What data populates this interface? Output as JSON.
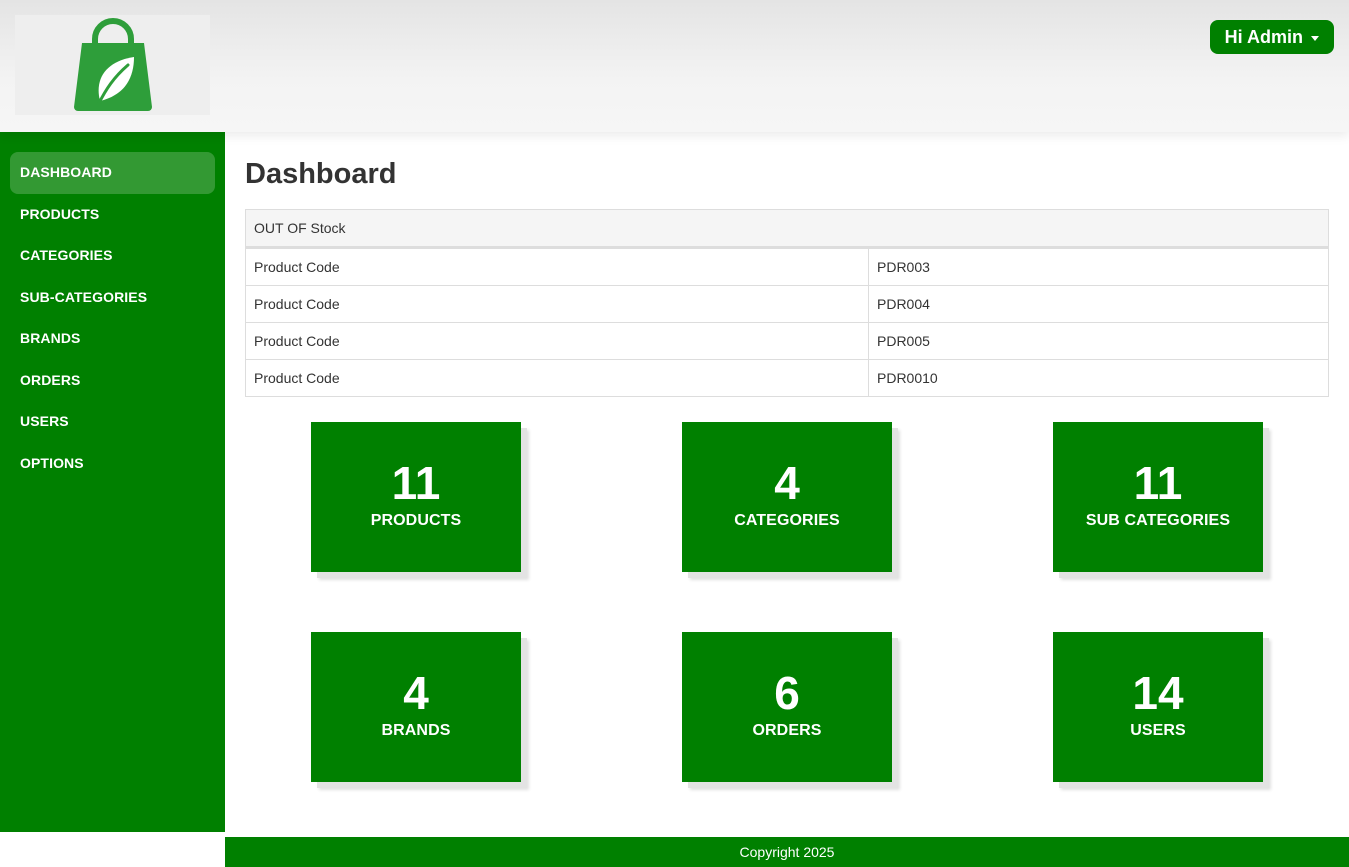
{
  "header": {
    "user_label": "Hi Admin",
    "brand_color": "#008000",
    "logo_icon": "shopping-bag-leaf-icon"
  },
  "sidebar": {
    "items": [
      {
        "label": "DASHBOARD",
        "active": true
      },
      {
        "label": "PRODUCTS"
      },
      {
        "label": "CATEGORIES"
      },
      {
        "label": "SUB-CATEGORIES"
      },
      {
        "label": "BRANDS"
      },
      {
        "label": "ORDERS"
      },
      {
        "label": "USERS"
      },
      {
        "label": "OPTIONS"
      }
    ]
  },
  "main": {
    "title": "Dashboard",
    "stock_table": {
      "heading": "OUT OF Stock",
      "rows": [
        {
          "label": "Product Code",
          "value": "PDR003"
        },
        {
          "label": "Product Code",
          "value": "PDR004"
        },
        {
          "label": "Product Code",
          "value": "PDR005"
        },
        {
          "label": "Product Code",
          "value": "PDR0010"
        }
      ]
    },
    "cards": [
      {
        "count": "11",
        "label": "PRODUCTS"
      },
      {
        "count": "4",
        "label": "CATEGORIES"
      },
      {
        "count": "11",
        "label": "SUB CATEGORIES"
      },
      {
        "count": "4",
        "label": "BRANDS"
      },
      {
        "count": "6",
        "label": "ORDERS"
      },
      {
        "count": "14",
        "label": "USERS"
      }
    ]
  },
  "footer": {
    "copyright": "Copyright 2025"
  }
}
